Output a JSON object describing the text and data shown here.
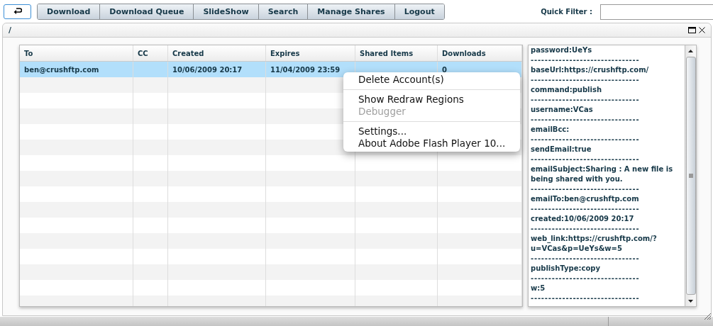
{
  "toolbar": {
    "buttons": [
      "Download",
      "Download Queue",
      "SlideShow",
      "Search",
      "Manage Shares",
      "Logout"
    ],
    "quick_filter": {
      "label": "Quick Filter :"
    }
  },
  "panel": {
    "title": "/"
  },
  "table": {
    "columns": [
      "To",
      "CC",
      "Created",
      "Expires",
      "Shared Items",
      "Downloads"
    ],
    "rows": [
      {
        "cells": [
          "ben@crushftp.com",
          "",
          "10/06/2009 20:17",
          "11/04/2009 23:59",
          "",
          "0"
        ],
        "selected": true
      }
    ]
  },
  "details": [
    {
      "kind": "field",
      "text": "password:UeYs"
    },
    {
      "kind": "divider",
      "text": "-------------------------------"
    },
    {
      "kind": "field",
      "text": "baseUrl:https://crushftp.com/"
    },
    {
      "kind": "divider",
      "text": "-------------------------------"
    },
    {
      "kind": "field",
      "text": "command:publish"
    },
    {
      "kind": "divider",
      "text": "-------------------------------"
    },
    {
      "kind": "field",
      "text": "username:VCas"
    },
    {
      "kind": "divider",
      "text": "-------------------------------"
    },
    {
      "kind": "field",
      "text": "emailBcc:"
    },
    {
      "kind": "divider",
      "text": "-------------------------------"
    },
    {
      "kind": "field",
      "text": "sendEmail:true"
    },
    {
      "kind": "divider",
      "text": "-------------------------------"
    },
    {
      "kind": "field",
      "text": "emailSubject:Sharing : A new file is being shared with you."
    },
    {
      "kind": "divider",
      "text": "-------------------------------"
    },
    {
      "kind": "field",
      "text": "emailTo:ben@crushftp.com"
    },
    {
      "kind": "divider",
      "text": "-------------------------------"
    },
    {
      "kind": "field",
      "text": "created:10/06/2009 20:17"
    },
    {
      "kind": "divider",
      "text": "-------------------------------"
    },
    {
      "kind": "field",
      "text": "web_link:https://crushftp.com/?u=VCas&p=UeYs&w=5"
    },
    {
      "kind": "divider",
      "text": "-------------------------------"
    },
    {
      "kind": "field",
      "text": "publishType:copy"
    },
    {
      "kind": "divider",
      "text": "-------------------------------"
    },
    {
      "kind": "field",
      "text": "w:5"
    },
    {
      "kind": "divider",
      "text": "-------------------------------"
    }
  ],
  "context_menu": {
    "groups": [
      [
        {
          "label": "Delete Account(s)",
          "disabled": false
        }
      ],
      [
        {
          "label": "Show Redraw Regions",
          "disabled": false
        },
        {
          "label": "Debugger",
          "disabled": true
        }
      ],
      [
        {
          "label": "Settings...",
          "disabled": false
        },
        {
          "label": "About Adobe Flash Player 10...",
          "disabled": false
        }
      ]
    ]
  }
}
